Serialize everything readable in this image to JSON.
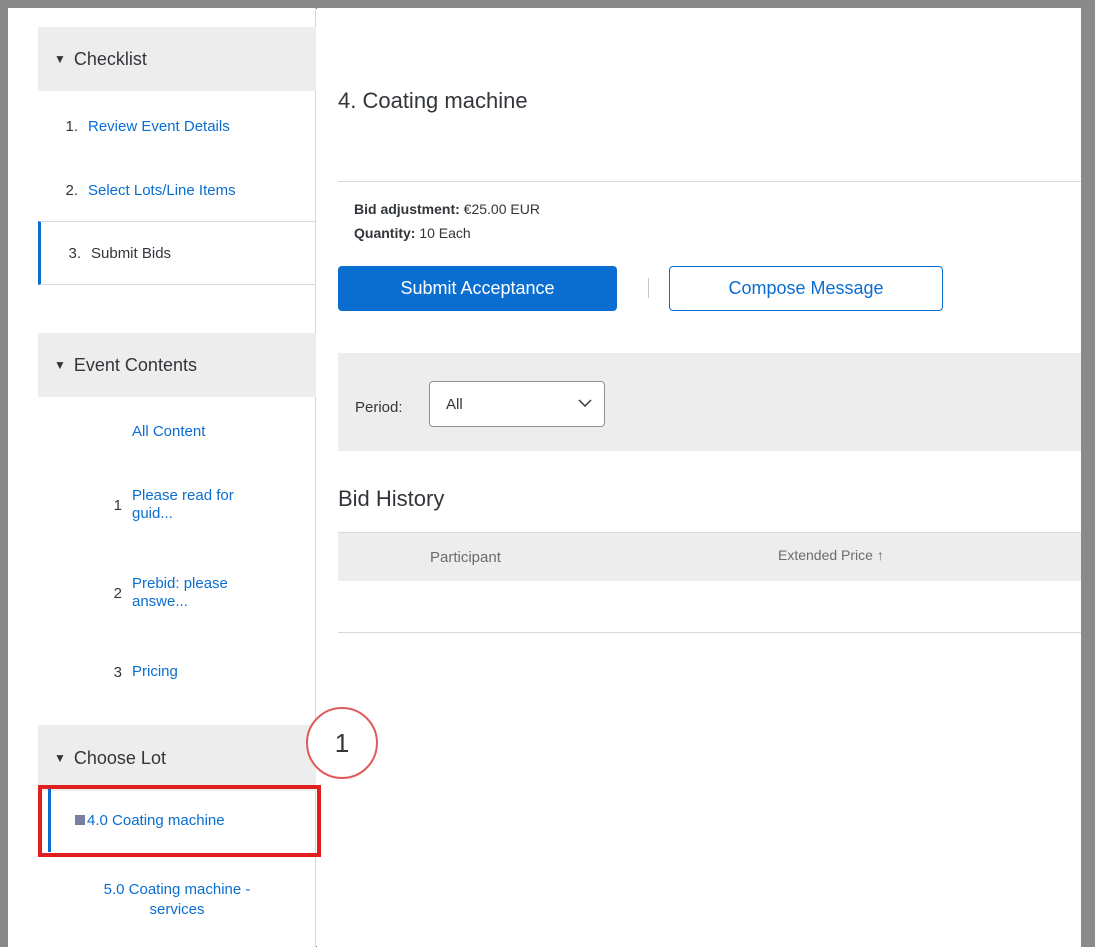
{
  "sidebar": {
    "checklist": {
      "header": "Checklist",
      "steps": [
        {
          "num": "1.",
          "label": "Review Event Details"
        },
        {
          "num": "2.",
          "label": "Select Lots/Line Items"
        },
        {
          "num": "3.",
          "label": "Submit Bids"
        }
      ]
    },
    "event_contents": {
      "header": "Event Contents",
      "all_content": "All Content",
      "items": [
        {
          "num": "1",
          "label_line1": "Please read for",
          "label_line2": "guid..."
        },
        {
          "num": "2",
          "label_line1": "Prebid: please",
          "label_line2": "answe..."
        },
        {
          "num": "3",
          "label_line1": "Pricing",
          "label_line2": ""
        }
      ]
    },
    "choose_lot": {
      "header": "Choose Lot",
      "lots": [
        {
          "label": "4.0 Coating machine"
        },
        {
          "label_line1": "5.0 Coating machine -",
          "label_line2": "services"
        }
      ]
    }
  },
  "main": {
    "title": "4. Coating machine",
    "bid_adjustment_label": "Bid adjustment:",
    "bid_adjustment_value": "€25.00 EUR",
    "quantity_label": "Quantity:",
    "quantity_value": "10 Each",
    "submit_button": "Submit Acceptance",
    "compose_button": "Compose Message",
    "filter": {
      "period_label": "Period:",
      "period_value": "All"
    },
    "bid_history": {
      "title": "Bid History",
      "columns": [
        "Participant",
        "Extended Price ↑"
      ]
    }
  },
  "annotation": {
    "callout_number": "1"
  },
  "colors": {
    "accent": "#0a6ed1",
    "header_bg": "#ededed",
    "highlight": "#e02020"
  }
}
